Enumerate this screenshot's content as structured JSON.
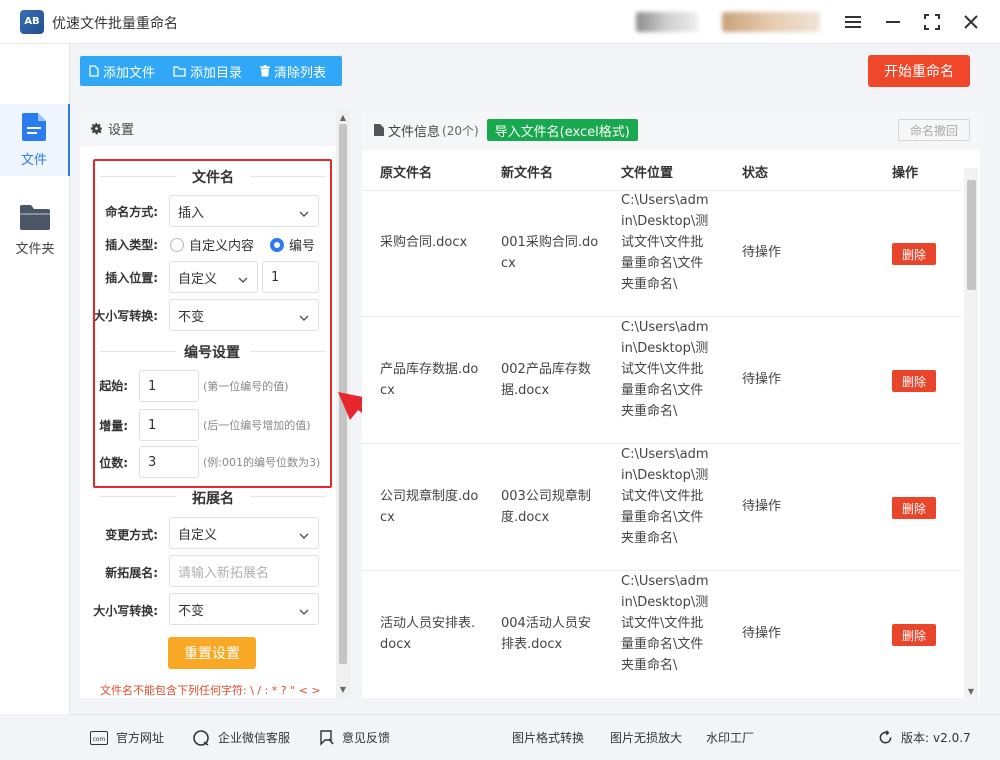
{
  "window": {
    "title": "优速文件批量重命名",
    "logo_text": "AB"
  },
  "sidebar": {
    "items": [
      {
        "label": "文件",
        "active": true
      },
      {
        "label": "文件夹",
        "active": false
      }
    ]
  },
  "toolbar": {
    "add_file": "添加文件",
    "add_dir": "添加目录",
    "clear_list": "清除列表",
    "start": "开始重命名"
  },
  "settings": {
    "header": "设置",
    "filename": {
      "title": "文件名",
      "naming_mode_label": "命名方式:",
      "naming_mode_value": "插入",
      "insert_type_label": "插入类型:",
      "insert_type_options": [
        "自定义内容",
        "编号"
      ],
      "insert_type_selected": "编号",
      "insert_pos_label": "插入位置:",
      "insert_pos_value": "自定义",
      "insert_pos_index": "1",
      "case_label": "大小写转换:",
      "case_value": "不变"
    },
    "numbering": {
      "title": "编号设置",
      "start_label": "起始:",
      "start_value": "1",
      "start_hint": "(第一位编号的值)",
      "step_label": "增量:",
      "step_value": "1",
      "step_hint": "(后一位编号增加的值)",
      "digits_label": "位数:",
      "digits_value": "3",
      "digits_hint": "(例:001的编号位数为3)"
    },
    "extension": {
      "title": "拓展名",
      "change_label": "变更方式:",
      "change_value": "自定义",
      "new_ext_label": "新拓展名:",
      "new_ext_placeholder": "请输入新拓展名",
      "case_label": "大小写转换:",
      "case_value": "不变"
    },
    "reset": "重置设置",
    "warning": "文件名不能包含下列任何字符: \\ / : * ? \" < >"
  },
  "file_info": {
    "title": "文件信息",
    "count": "(20个)",
    "import_btn": "导入文件名(excel格式)",
    "undo_btn": "命名撤回",
    "columns": [
      "原文件名",
      "新文件名",
      "文件位置",
      "状态",
      "操作"
    ],
    "rows": [
      {
        "orig": "采购合同.docx",
        "new": "001采购合同.docx",
        "path": "C:\\Users\\admin\\Desktop\\测试文件\\文件批量重命名\\文件夹重命名\\",
        "status": "待操作",
        "action": "删除"
      },
      {
        "orig": "产品库存数据.docx",
        "new": "002产品库存数据.docx",
        "path": "C:\\Users\\admin\\Desktop\\测试文件\\文件批量重命名\\文件夹重命名\\",
        "status": "待操作",
        "action": "删除"
      },
      {
        "orig": "公司规章制度.docx",
        "new": "003公司规章制度.docx",
        "path": "C:\\Users\\admin\\Desktop\\测试文件\\文件批量重命名\\文件夹重命名\\",
        "status": "待操作",
        "action": "删除"
      },
      {
        "orig": "活动人员安排表.docx",
        "new": "004活动人员安排表.docx",
        "path": "C:\\Users\\admin\\Desktop\\测试文件\\文件批量重命名\\文件夹重命名\\",
        "status": "待操作",
        "action": "删除"
      }
    ]
  },
  "footer": {
    "official_site": "官方网址",
    "wechat": "企业微信客服",
    "feedback": "意见反馈",
    "img_convert": "图片格式转换",
    "img_enlarge": "图片无损放大",
    "watermark": "水印工厂",
    "version_label": "版本:",
    "version": "v2.0.7",
    "com_text": "com"
  },
  "colors": {
    "accent": "#2b7bf1",
    "toolbar": "#30a8f7",
    "start": "#f0462a",
    "import": "#18a84d",
    "reset": "#f9a825",
    "delete": "#e8452a",
    "highlight": "#e8262d"
  }
}
